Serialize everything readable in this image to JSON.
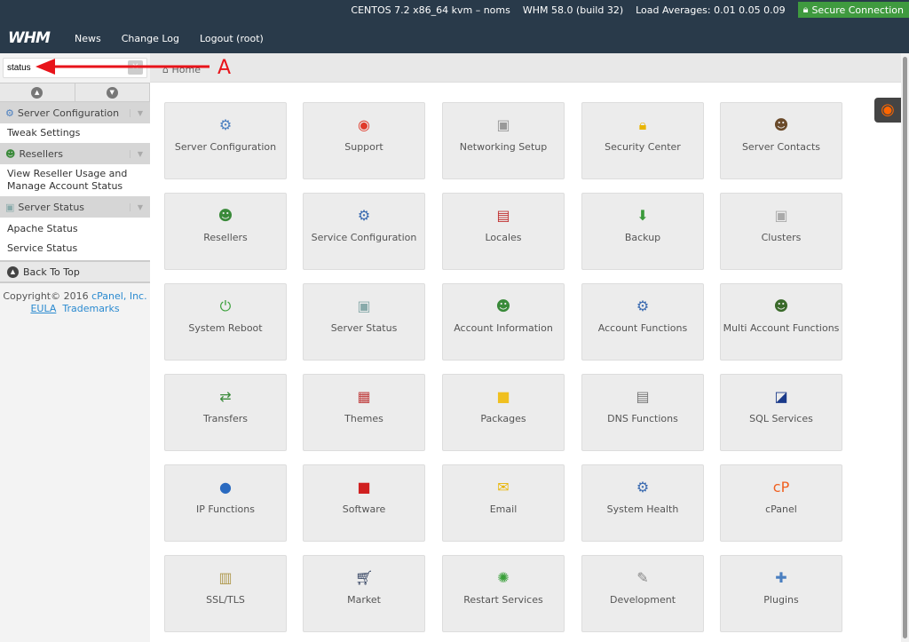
{
  "header": {
    "system": "CENTOS 7.2 x86_64 kvm – noms",
    "version": "WHM 58.0 (build 32)",
    "load": "Load Averages: 0.01 0.05 0.09",
    "secure": "Secure Connection",
    "logo": "WHM",
    "nav": [
      "News",
      "Change Log",
      "Logout (root)"
    ]
  },
  "sidebar": {
    "search_value": "status",
    "groups": [
      {
        "title": "Server Configuration",
        "items": [
          "Tweak Settings"
        ]
      },
      {
        "title": "Resellers",
        "items": [
          "View Reseller Usage and Manage Account Status"
        ]
      },
      {
        "title": "Server Status",
        "items": [
          "Apache Status",
          "Service Status"
        ]
      }
    ],
    "back_to_top": "Back To Top",
    "copyright": "Copyright© 2016",
    "company": "cPanel, Inc.",
    "eula": "EULA",
    "trademarks": "Trademarks"
  },
  "breadcrumb": "Home",
  "annotation": "A",
  "tiles": [
    {
      "label": "Server Configuration",
      "icon": "server-config-icon",
      "g": "⚙",
      "c": "#4a7fc0"
    },
    {
      "label": "Support",
      "icon": "lifebuoy-icon",
      "g": "◉",
      "c": "#e03a2a"
    },
    {
      "label": "Networking Setup",
      "icon": "network-icon",
      "g": "▣",
      "c": "#999"
    },
    {
      "label": "Security Center",
      "icon": "lock-icon",
      "g": "🔒︎",
      "c": "#e8b400"
    },
    {
      "label": "Server Contacts",
      "icon": "contact-icon",
      "g": "☻",
      "c": "#6a4a2a"
    },
    {
      "label": "Resellers",
      "icon": "resellers-icon",
      "g": "☻",
      "c": "#3a8a3a"
    },
    {
      "label": "Service Configuration",
      "icon": "gear-icon",
      "g": "⚙",
      "c": "#3a6ab0"
    },
    {
      "label": "Locales",
      "icon": "flag-icon",
      "g": "▤",
      "c": "#c03030"
    },
    {
      "label": "Backup",
      "icon": "backup-icon",
      "g": "⬇",
      "c": "#3a9a3a"
    },
    {
      "label": "Clusters",
      "icon": "clusters-icon",
      "g": "▣",
      "c": "#aaa"
    },
    {
      "label": "System Reboot",
      "icon": "power-icon",
      "g": "⏻",
      "c": "#3aa03a"
    },
    {
      "label": "Server Status",
      "icon": "server-status-icon",
      "g": "▣",
      "c": "#8aa"
    },
    {
      "label": "Account Information",
      "icon": "account-info-icon",
      "g": "☻",
      "c": "#3a8a3a"
    },
    {
      "label": "Account Functions",
      "icon": "account-functions-icon",
      "g": "⚙",
      "c": "#3a6ab0"
    },
    {
      "label": "Multi Account Functions",
      "icon": "multi-account-icon",
      "g": "☻",
      "c": "#3a6a2a"
    },
    {
      "label": "Transfers",
      "icon": "transfers-icon",
      "g": "⇄",
      "c": "#3a8a3a"
    },
    {
      "label": "Themes",
      "icon": "themes-icon",
      "g": "▦",
      "c": "#c04040"
    },
    {
      "label": "Packages",
      "icon": "package-icon",
      "g": "■",
      "c": "#f0c020"
    },
    {
      "label": "DNS Functions",
      "icon": "dns-icon",
      "g": "▤",
      "c": "#777"
    },
    {
      "label": "SQL Services",
      "icon": "sql-icon",
      "g": "◪",
      "c": "#1a3a8a"
    },
    {
      "label": "IP Functions",
      "icon": "globe-icon",
      "g": "●",
      "c": "#2a6ac0"
    },
    {
      "label": "Software",
      "icon": "software-icon",
      "g": "■",
      "c": "#d02020"
    },
    {
      "label": "Email",
      "icon": "email-icon",
      "g": "✉",
      "c": "#e8b400"
    },
    {
      "label": "System Health",
      "icon": "system-health-icon",
      "g": "⚙",
      "c": "#3a6ab0"
    },
    {
      "label": "cPanel",
      "icon": "cpanel-icon",
      "g": "cP",
      "c": "#f06020"
    },
    {
      "label": "SSL/TLS",
      "icon": "certificate-icon",
      "g": "▥",
      "c": "#b09a50"
    },
    {
      "label": "Market",
      "icon": "cart-icon",
      "g": "🛒︎",
      "c": "#2a3a5a"
    },
    {
      "label": "Restart Services",
      "icon": "restart-icon",
      "g": "✺",
      "c": "#3aa03a"
    },
    {
      "label": "Development",
      "icon": "development-icon",
      "g": "✎",
      "c": "#888"
    },
    {
      "label": "Plugins",
      "icon": "plugins-icon",
      "g": "✚",
      "c": "#4a7fc0"
    }
  ],
  "colors": {
    "header": "#293a4a",
    "secure": "#3f9a3f",
    "annotation": "#e8131a"
  }
}
